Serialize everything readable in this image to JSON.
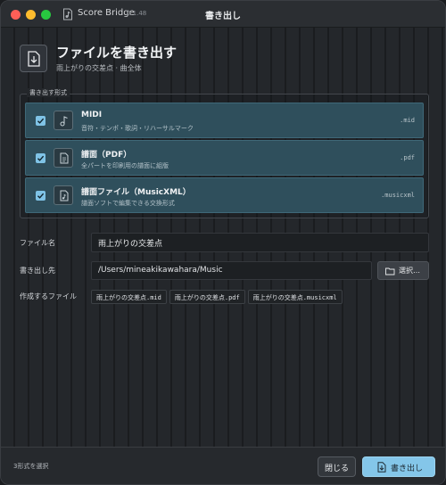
{
  "titlebar": {
    "app_name": "Score Bridge",
    "version": "0.1.48",
    "window_title": "書き出し"
  },
  "header": {
    "title": "ファイルを書き出す",
    "subtitle": "雨上がりの交差点 · 曲全体",
    "icon": "file-export-icon"
  },
  "formats": {
    "group_label": "書き出す形式",
    "items": [
      {
        "name": "MIDI",
        "description": "音符・テンポ・歌詞・リハーサルマーク",
        "ext": ".mid",
        "checked": true,
        "icon": "music-note-icon"
      },
      {
        "name": "譜面（PDF）",
        "description": "全パートを印刷用の譜面に組版",
        "ext": ".pdf",
        "checked": true,
        "icon": "document-icon"
      },
      {
        "name": "譜面ファイル（MusicXML）",
        "description": "譜面ソフトで編集できる交換形式",
        "ext": ".musicxml",
        "checked": true,
        "icon": "score-file-icon"
      }
    ]
  },
  "fields": {
    "filename_label": "ファイル名",
    "filename_value": "雨上がりの交差点",
    "destination_label": "書き出し先",
    "destination_value": "/Users/mineakikawahara/Music",
    "browse_label": "選択…",
    "files_label": "作成するファイル",
    "files": [
      "雨上がりの交差点.mid",
      "雨上がりの交差点.pdf",
      "雨上がりの交差点.musicxml"
    ]
  },
  "footer": {
    "status": "3形式を選択",
    "close_label": "閉じる",
    "export_label": "書き出し"
  },
  "colors": {
    "accent": "#84c6e9",
    "row_bg": "#2f4f5c",
    "window_bg": "#24272b"
  }
}
